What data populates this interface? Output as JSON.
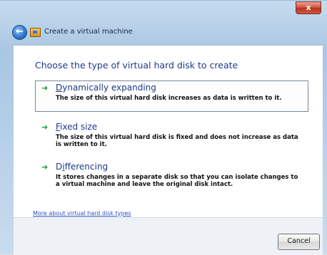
{
  "window": {
    "title": "Create a virtual machine",
    "close_label": "x"
  },
  "icons": {
    "back": "back-arrow-icon",
    "app": "virtual-machine-icon",
    "option_arrow": "green-arrow-icon"
  },
  "content": {
    "heading": "Choose the type of virtual hard disk to create",
    "options": [
      {
        "mnemonic": "D",
        "title_rest": "ynamically expanding",
        "description": "The size of this virtual hard disk increases as data is written to it.",
        "selected": true
      },
      {
        "mnemonic": "F",
        "title_rest": "ixed size",
        "description": "The size of this virtual hard disk is fixed and does not increase as data is written to it.",
        "selected": false
      },
      {
        "title_pre": "D",
        "mnemonic": "i",
        "title_rest": "fferencing",
        "description": "It stores changes in a separate disk so that you can isolate changes to a virtual machine and leave the original disk intact.",
        "selected": false
      }
    ],
    "link": "More about virtual hard disk types"
  },
  "footer": {
    "cancel_label": "Cancel"
  },
  "colors": {
    "heading": "#1e3a8a",
    "arrow": "#1f9e3e",
    "link": "#2a52be"
  }
}
